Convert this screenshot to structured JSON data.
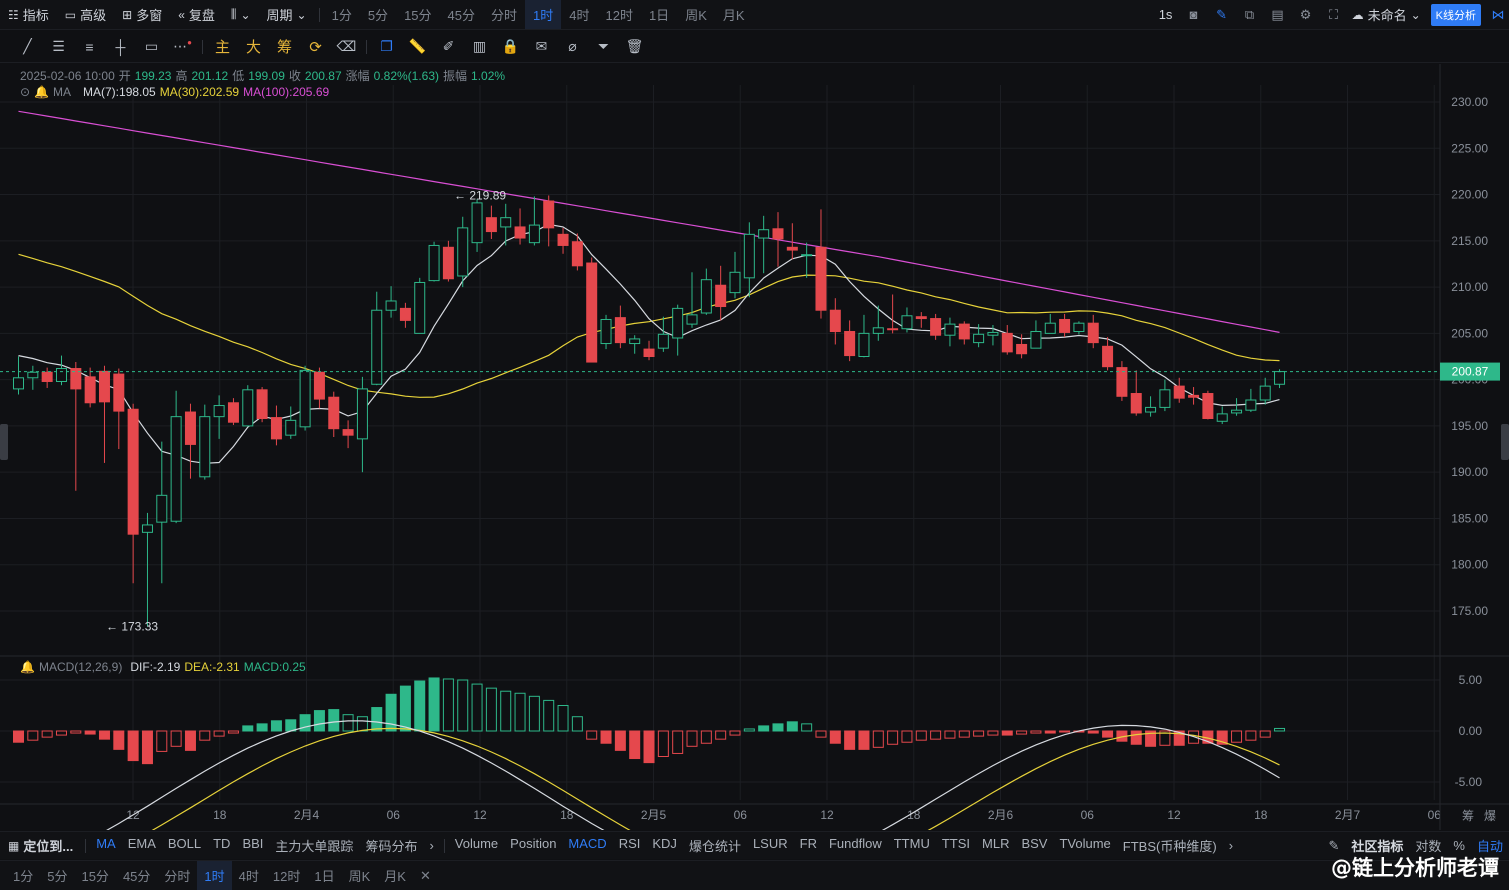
{
  "topbar": {
    "left_items": [
      {
        "icon": "indicator-icon",
        "label": "指标"
      },
      {
        "icon": "advanced-icon",
        "label": "高级"
      },
      {
        "icon": "multiwindow-icon",
        "label": "多窗"
      },
      {
        "icon": "replay-icon",
        "label": "复盘"
      },
      {
        "icon": "candle-type-icon",
        "label": ""
      },
      {
        "icon": "",
        "label": "周期"
      }
    ],
    "periods": [
      "1分",
      "5分",
      "15分",
      "45分",
      "分时",
      "1时",
      "4时",
      "12时",
      "1日",
      "周K",
      "月K"
    ],
    "active_period": "1时",
    "right": {
      "interval": "1s",
      "layout_name": "未命名",
      "analysis_button": "K线分析"
    }
  },
  "toolbar": {
    "gold_tools": [
      "主",
      "大",
      "筹"
    ]
  },
  "info": {
    "date": "2025-02-06 10:00",
    "open_label": "开",
    "open": "199.23",
    "high_label": "高",
    "high": "201.12",
    "low_label": "低",
    "low": "199.09",
    "close_label": "收",
    "close": "200.87",
    "change_label": "涨幅",
    "change": "0.82%(1.63)",
    "amp_label": "振幅",
    "amp": "1.02%",
    "ma_label": "MA",
    "ma7": "MA(7):198.05",
    "ma30": "MA(30):202.59",
    "ma100": "MA(100):205.69",
    "macd_label": "MACD(12,26,9)",
    "dif": "DIF:-2.19",
    "dea": "DEA:-2.31",
    "macd": "MACD:0.25"
  },
  "colors": {
    "up": "#2eb88a",
    "down": "#e5484d",
    "ma7": "#d6dae0",
    "ma30": "#e6d23a",
    "ma100": "#d94fd4",
    "accent": "#2f7cf6"
  },
  "chart_data": {
    "type": "candlestick",
    "price_axis": {
      "min": 170,
      "max": 232,
      "ticks": [
        "230.00",
        "225.00",
        "220.00",
        "215.00",
        "210.00",
        "205.00",
        "200.00",
        "195.00",
        "190.00",
        "185.00",
        "180.00",
        "175.00"
      ]
    },
    "last_price": "200.87",
    "high_marker": "← 219.89",
    "low_marker": "← 173.33",
    "macd_axis": {
      "ticks": [
        "5.00",
        "0.00",
        "-5.00"
      ]
    },
    "time_labels": [
      "12",
      "18",
      "2月4",
      "06",
      "12",
      "18",
      "2月5",
      "06",
      "12",
      "18",
      "2月6",
      "06",
      "12",
      "18",
      "2月7",
      "06"
    ],
    "candles": [
      [
        199.0,
        200.2,
        202.5,
        198.4
      ],
      [
        200.2,
        200.8,
        201.5,
        198.9
      ],
      [
        200.8,
        199.8,
        201.3,
        199.1
      ],
      [
        199.8,
        201.2,
        202.6,
        199.4
      ],
      [
        201.2,
        199.0,
        201.9,
        188.0
      ],
      [
        200.3,
        197.5,
        201.3,
        197.0
      ],
      [
        200.9,
        197.6,
        201.5,
        191.0
      ],
      [
        200.6,
        196.6,
        201.2,
        192.5
      ],
      [
        196.8,
        183.3,
        197.4,
        178.0
      ],
      [
        183.5,
        184.3,
        185.6,
        173.3
      ],
      [
        184.6,
        187.5,
        193.3,
        178.0
      ],
      [
        184.7,
        196.0,
        198.8,
        184.5
      ],
      [
        196.5,
        193.0,
        197.4,
        189.3
      ],
      [
        189.5,
        196.0,
        197.3,
        189.2
      ],
      [
        196.0,
        197.2,
        198.3,
        193.6
      ],
      [
        197.5,
        195.4,
        198.0,
        195.1
      ],
      [
        195.0,
        198.9,
        199.4,
        195.0
      ],
      [
        198.9,
        195.8,
        199.2,
        195.4
      ],
      [
        195.9,
        193.6,
        197.2,
        192.9
      ],
      [
        194.0,
        195.6,
        197.1,
        193.6
      ],
      [
        194.9,
        201.0,
        201.5,
        194.5
      ],
      [
        200.8,
        197.9,
        201.3,
        196.9
      ],
      [
        198.1,
        194.7,
        198.7,
        193.8
      ],
      [
        194.6,
        194.0,
        195.6,
        192.6
      ],
      [
        193.6,
        199.0,
        200.3,
        190.0
      ],
      [
        199.5,
        207.5,
        209.5,
        199.4
      ],
      [
        207.5,
        208.5,
        210.1,
        206.7
      ],
      [
        207.7,
        206.4,
        208.3,
        205.6
      ],
      [
        205.0,
        210.5,
        211.0,
        205.0
      ],
      [
        210.7,
        214.5,
        214.9,
        210.6
      ],
      [
        214.3,
        210.9,
        215.0,
        210.6
      ],
      [
        211.2,
        216.4,
        217.6,
        210.0
      ],
      [
        214.8,
        219.1,
        219.5,
        213.8
      ],
      [
        217.5,
        216.0,
        218.8,
        215.2
      ],
      [
        216.5,
        217.5,
        219.0,
        214.5
      ],
      [
        216.5,
        215.3,
        218.5,
        214.6
      ],
      [
        214.8,
        216.7,
        219.8,
        214.5
      ],
      [
        219.3,
        216.4,
        219.9,
        214.4
      ],
      [
        215.7,
        214.5,
        216.4,
        213.6
      ],
      [
        214.9,
        212.3,
        215.8,
        211.8
      ],
      [
        212.6,
        201.9,
        213.2,
        202.0
      ],
      [
        203.9,
        206.5,
        207.0,
        203.3
      ],
      [
        206.7,
        204.0,
        208.0,
        203.4
      ],
      [
        203.9,
        204.4,
        204.8,
        202.8
      ],
      [
        203.3,
        202.5,
        204.2,
        202.1
      ],
      [
        203.4,
        204.9,
        206.8,
        203.0
      ],
      [
        204.5,
        207.7,
        208.1,
        202.6
      ],
      [
        206.0,
        207.0,
        211.6,
        205.6
      ],
      [
        207.2,
        210.8,
        212.0,
        207.0
      ],
      [
        210.2,
        207.9,
        212.3,
        206.4
      ],
      [
        209.4,
        211.6,
        213.8,
        208.8
      ],
      [
        211.0,
        215.7,
        217.0,
        208.9
      ],
      [
        215.3,
        216.2,
        217.7,
        211.5
      ],
      [
        216.3,
        215.2,
        218.1,
        212.2
      ],
      [
        214.3,
        214.0,
        216.9,
        213.0
      ],
      [
        213.5,
        213.5,
        214.8,
        211.0
      ],
      [
        214.3,
        207.5,
        218.4,
        206.6
      ],
      [
        207.5,
        205.2,
        208.8,
        203.8
      ],
      [
        205.2,
        202.6,
        206.4,
        202.0
      ],
      [
        202.5,
        205.0,
        207.0,
        202.4
      ],
      [
        205.0,
        205.6,
        208.0,
        204.2
      ],
      [
        205.5,
        205.4,
        209.2,
        205.0
      ],
      [
        205.5,
        206.9,
        207.8,
        205.1
      ],
      [
        206.8,
        206.6,
        207.3,
        205.6
      ],
      [
        206.6,
        204.8,
        207.1,
        204.3
      ],
      [
        204.8,
        206.0,
        206.7,
        203.6
      ],
      [
        206.0,
        204.4,
        206.3,
        203.8
      ],
      [
        204.0,
        204.9,
        206.0,
        203.5
      ],
      [
        204.8,
        205.1,
        205.9,
        203.7
      ],
      [
        205.0,
        203.0,
        205.9,
        202.7
      ],
      [
        203.8,
        202.8,
        204.9,
        202.3
      ],
      [
        203.4,
        205.2,
        206.4,
        203.4
      ],
      [
        205.0,
        206.1,
        207.1,
        205.0
      ],
      [
        206.5,
        205.1,
        207.1,
        204.6
      ],
      [
        205.2,
        206.1,
        206.3,
        204.9
      ],
      [
        206.1,
        204.0,
        207.0,
        203.4
      ],
      [
        203.6,
        201.4,
        204.6,
        201.0
      ],
      [
        201.3,
        198.2,
        202.0,
        197.7
      ],
      [
        198.5,
        196.4,
        201.0,
        196.1
      ],
      [
        196.5,
        197.0,
        198.2,
        196.0
      ],
      [
        197.0,
        198.9,
        200.0,
        196.6
      ],
      [
        199.3,
        198.0,
        200.2,
        197.5
      ],
      [
        198.3,
        198.1,
        199.2,
        197.3
      ],
      [
        198.5,
        195.8,
        198.8,
        195.7
      ],
      [
        195.5,
        196.3,
        197.1,
        195.2
      ],
      [
        196.4,
        196.7,
        198.0,
        196.1
      ],
      [
        196.7,
        197.8,
        199.0,
        196.5
      ],
      [
        197.8,
        199.3,
        200.2,
        197.3
      ],
      [
        199.5,
        200.87,
        201.12,
        199.09
      ]
    ],
    "macd_hist": [
      -1.1,
      -0.9,
      -0.6,
      -0.4,
      -0.2,
      -0.3,
      -0.8,
      -1.8,
      -2.9,
      -3.2,
      -2.0,
      -1.5,
      -1.9,
      -0.9,
      -0.5,
      -0.2,
      0.5,
      0.7,
      1.0,
      1.1,
      1.6,
      2.0,
      2.1,
      1.6,
      1.4,
      2.3,
      3.6,
      4.4,
      4.9,
      5.2,
      5.1,
      5.0,
      4.6,
      4.2,
      3.9,
      3.7,
      3.4,
      3.0,
      2.5,
      1.4,
      -0.8,
      -1.2,
      -1.9,
      -2.7,
      -3.1,
      -2.5,
      -2.2,
      -1.5,
      -1.2,
      -0.8,
      -0.4,
      0.2,
      0.5,
      0.7,
      0.9,
      0.7,
      -0.6,
      -1.2,
      -1.8,
      -1.8,
      -1.6,
      -1.3,
      -1.1,
      -0.9,
      -0.8,
      -0.7,
      -0.6,
      -0.5,
      -0.4,
      -0.4,
      -0.3,
      -0.2,
      -0.2,
      -0.1,
      -0.1,
      -0.2,
      -0.6,
      -1.0,
      -1.3,
      -1.5,
      -1.4,
      -1.4,
      -1.2,
      -1.2,
      -1.3,
      -1.1,
      -0.9,
      -0.6,
      0.25
    ]
  },
  "indicator_bar": {
    "locate": "定位到...",
    "main_indicators": [
      "MA",
      "EMA",
      "BOLL",
      "TD",
      "BBI",
      "主力大单跟踪",
      "筹码分布"
    ],
    "sub_indicators": [
      "Volume",
      "Position",
      "MACD",
      "RSI",
      "KDJ",
      "爆仓统计",
      "LSUR",
      "FR",
      "Fundflow",
      "TTMU",
      "TTSI",
      "MLR",
      "BSV",
      "TVolume",
      "FTBS(币种维度)"
    ],
    "right": [
      "社区指标",
      "对数",
      "%",
      "自动"
    ]
  },
  "bottom_periods": [
    "1分",
    "5分",
    "15分",
    "45分",
    "分时",
    "1时",
    "4时",
    "12时",
    "1日",
    "周K",
    "月K"
  ],
  "watermark": "@链上分析师老谭"
}
